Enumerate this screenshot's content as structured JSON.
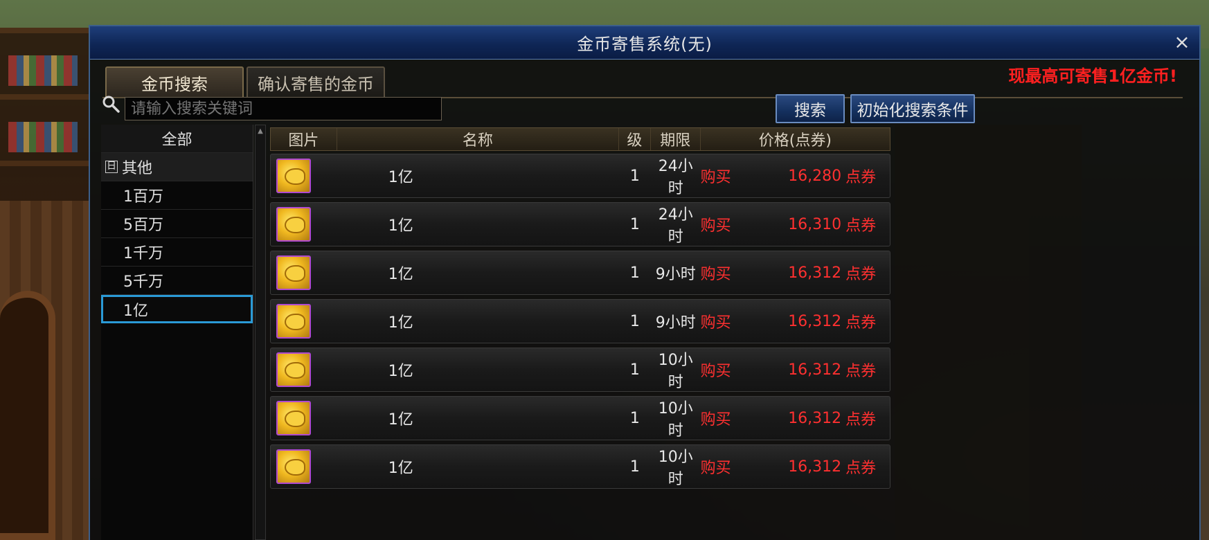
{
  "window": {
    "title": "金币寄售系统(无)",
    "close_glyph": "×"
  },
  "tabs": [
    {
      "label": "金币搜索",
      "active": true
    },
    {
      "label": "确认寄售的金币",
      "active": false
    }
  ],
  "notice": "现最高可寄售1亿金币!",
  "search": {
    "placeholder": "请输入搜索关键词",
    "search_button": "搜索",
    "reset_button": "初始化搜索条件"
  },
  "categories": {
    "all": "全部",
    "group_label": "其他",
    "group_toggle": "日",
    "items": [
      "1百万",
      "5百万",
      "1千万",
      "5千万",
      "1亿"
    ],
    "selected": "1亿"
  },
  "table": {
    "headers": {
      "image": "图片",
      "name": "名称",
      "level": "级",
      "period": "期限",
      "price": "价格(点券)"
    },
    "rows": [
      {
        "name": "1亿",
        "level": "1",
        "period": "24小时",
        "buy": "购买",
        "price": "16,280",
        "unit": "点券"
      },
      {
        "name": "1亿",
        "level": "1",
        "period": "24小时",
        "buy": "购买",
        "price": "16,310",
        "unit": "点券"
      },
      {
        "name": "1亿",
        "level": "1",
        "period": "9小时",
        "buy": "购买",
        "price": "16,312",
        "unit": "点券"
      },
      {
        "name": "1亿",
        "level": "1",
        "period": "9小时",
        "buy": "购买",
        "price": "16,312",
        "unit": "点券"
      },
      {
        "name": "1亿",
        "level": "1",
        "period": "10小时",
        "buy": "购买",
        "price": "16,312",
        "unit": "点券"
      },
      {
        "name": "1亿",
        "level": "1",
        "period": "10小时",
        "buy": "购买",
        "price": "16,312",
        "unit": "点券"
      },
      {
        "name": "1亿",
        "level": "1",
        "period": "10小时",
        "buy": "购买",
        "price": "16,312",
        "unit": "点券"
      }
    ]
  },
  "colors": {
    "title_bar": "#0f2656",
    "price_red": "#ff3030",
    "selected_border": "#2a9ad6",
    "item_border": "#b04ad0"
  },
  "icons": {
    "search": "search-icon",
    "close": "close-icon",
    "item": "gold-coin-icon"
  }
}
